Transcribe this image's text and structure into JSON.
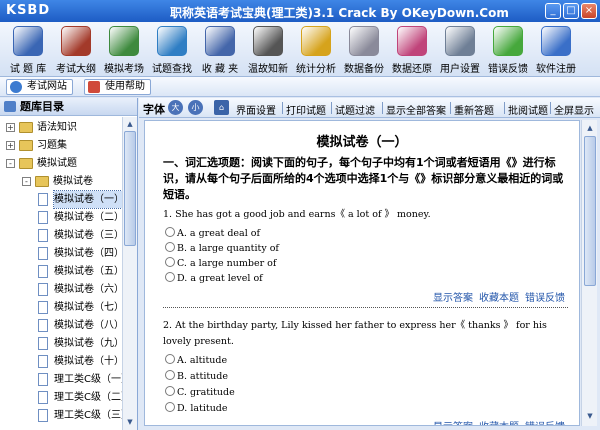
{
  "window": {
    "logo": "KSBD",
    "title": "职称英语考试宝典(理工类)3.1 Crack By OKeyDown.Com",
    "min_icon": "minimize-icon",
    "max_icon": "maximize-icon",
    "close_icon": "close-icon"
  },
  "toolbar": {
    "items": [
      {
        "label": "试 题 库",
        "icon": "question-bank-icon",
        "color": "#3a66b4"
      },
      {
        "label": "考试大纲",
        "icon": "syllabus-icon",
        "color": "#a33a2a"
      },
      {
        "label": "模拟考场",
        "icon": "mock-exam-icon",
        "color": "#3e8a3e"
      },
      {
        "label": "试题查找",
        "icon": "search-icon",
        "color": "#2f7ec4"
      },
      {
        "label": "收 藏 夹",
        "icon": "favorites-icon",
        "color": "#4466aa"
      },
      {
        "label": "温故知新",
        "icon": "review-icon",
        "color": "#555555"
      },
      {
        "label": "统计分析",
        "icon": "statistics-icon",
        "color": "#d6a31c"
      },
      {
        "label": "数据备份",
        "icon": "backup-icon",
        "color": "#8a8a9a"
      },
      {
        "label": "数据还原",
        "icon": "restore-icon",
        "color": "#c0447a"
      },
      {
        "label": "用户设置",
        "icon": "user-settings-icon",
        "color": "#6f7f96"
      },
      {
        "label": "错误反馈",
        "icon": "feedback-icon",
        "color": "#46a83c"
      },
      {
        "label": "软件注册",
        "icon": "register-icon",
        "color": "#3a6fc8"
      }
    ]
  },
  "navbar": {
    "site": "考试网站",
    "help": "使用帮助"
  },
  "leftpanel": {
    "header": "题库目录",
    "tree": [
      {
        "label": "语法知识",
        "kind": "folder",
        "exp": "+"
      },
      {
        "label": "习题集",
        "kind": "folder",
        "exp": "+"
      },
      {
        "label": "模拟试题",
        "kind": "folder",
        "exp": "-"
      },
      {
        "label": "模拟试卷",
        "kind": "folder",
        "exp": "-"
      },
      {
        "label": "模拟试卷（一）",
        "kind": "doc",
        "selected": true
      },
      {
        "label": "模拟试卷（二）",
        "kind": "doc"
      },
      {
        "label": "模拟试卷（三）",
        "kind": "doc"
      },
      {
        "label": "模拟试卷（四）",
        "kind": "doc"
      },
      {
        "label": "模拟试卷（五）",
        "kind": "doc"
      },
      {
        "label": "模拟试卷（六）",
        "kind": "doc"
      },
      {
        "label": "模拟试卷（七）",
        "kind": "doc"
      },
      {
        "label": "模拟试卷（八）",
        "kind": "doc"
      },
      {
        "label": "模拟试卷（九）",
        "kind": "doc"
      },
      {
        "label": "模拟试卷（十）",
        "kind": "doc"
      },
      {
        "label": "理工类C级（一）",
        "kind": "doc"
      },
      {
        "label": "理工类C级（二）",
        "kind": "doc"
      },
      {
        "label": "理工类C级（三）",
        "kind": "doc"
      }
    ]
  },
  "rightbar": {
    "font_label": "字体",
    "font_big": "大",
    "font_small": "小",
    "items": [
      "界面设置",
      "打印试题",
      "试题过滤",
      "显示全部答案",
      "重新答题",
      "批阅试题",
      "全屏显示"
    ]
  },
  "content": {
    "title": "模拟试卷（一）",
    "section": "一、词汇选项题：阅读下面的句子，每个句子中均有1个词或者短语用《》进行标识，请从每个句子后面所给的4个选项中选择1个与《》标识部分意义最相近的词或短语。",
    "questions": [
      {
        "text": "1. She has got a good job and earns《 a lot of 》 money.",
        "options": [
          "A. a great deal of",
          "B. a large quantity of",
          "C. a large number of",
          "D. a great level of"
        ]
      },
      {
        "text": "2. At the birthday party, Lily kissed her father to express her《 thanks 》 for his lovely present.",
        "options": [
          "A. altitude",
          "B. attitude",
          "C. gratitude",
          "D. latitude"
        ]
      }
    ],
    "links": [
      "显示答案",
      "收藏本题",
      "错误反馈"
    ]
  }
}
